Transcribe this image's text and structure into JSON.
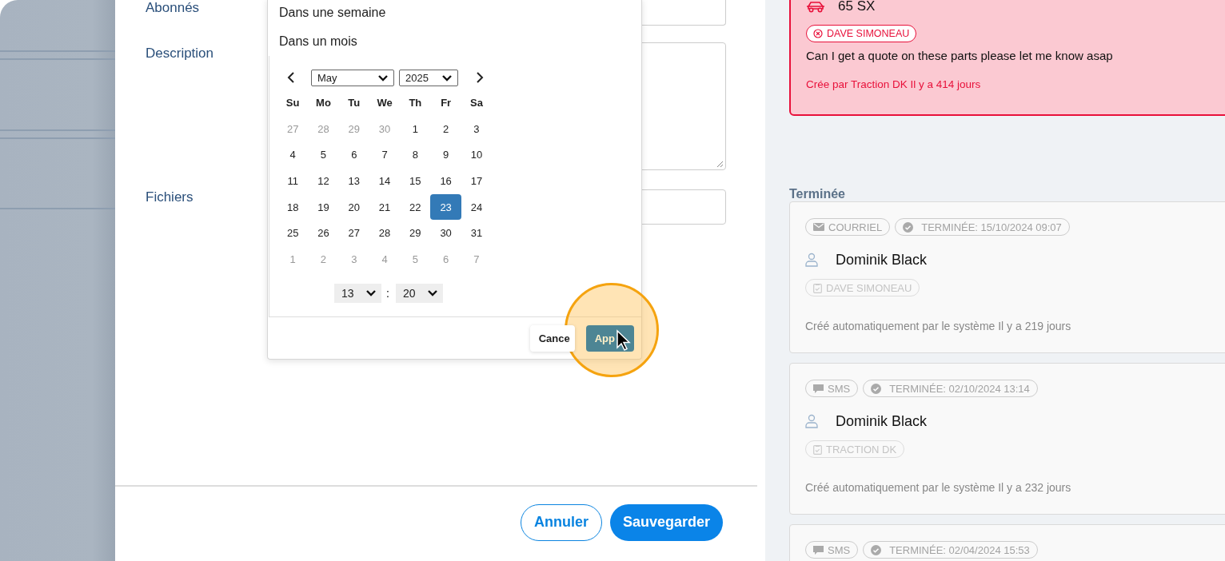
{
  "form": {
    "fields": [
      {
        "label": "Abonnés",
        "kind": "input"
      },
      {
        "label": "Description",
        "kind": "textarea"
      },
      {
        "label": "Fichiers",
        "kind": "file"
      }
    ]
  },
  "date_popover": {
    "presets": [
      "Dans une semaine",
      "Dans un mois"
    ],
    "calendar": {
      "month": "May",
      "year": "2025",
      "weekdays": [
        "Su",
        "Mo",
        "Tu",
        "We",
        "Th",
        "Fr",
        "Sa"
      ],
      "weeks": [
        [
          {
            "day": "27",
            "outside": true,
            "selected": false
          },
          {
            "day": "28",
            "outside": true,
            "selected": false
          },
          {
            "day": "29",
            "outside": true,
            "selected": false
          },
          {
            "day": "30",
            "outside": true,
            "selected": false
          },
          {
            "day": "1",
            "outside": false,
            "selected": false
          },
          {
            "day": "2",
            "outside": false,
            "selected": false
          },
          {
            "day": "3",
            "outside": false,
            "selected": false
          }
        ],
        [
          {
            "day": "4",
            "outside": false,
            "selected": false
          },
          {
            "day": "5",
            "outside": false,
            "selected": false
          },
          {
            "day": "6",
            "outside": false,
            "selected": false
          },
          {
            "day": "7",
            "outside": false,
            "selected": false
          },
          {
            "day": "8",
            "outside": false,
            "selected": false
          },
          {
            "day": "9",
            "outside": false,
            "selected": false
          },
          {
            "day": "10",
            "outside": false,
            "selected": false
          }
        ],
        [
          {
            "day": "11",
            "outside": false,
            "selected": false
          },
          {
            "day": "12",
            "outside": false,
            "selected": false
          },
          {
            "day": "13",
            "outside": false,
            "selected": false
          },
          {
            "day": "14",
            "outside": false,
            "selected": false
          },
          {
            "day": "15",
            "outside": false,
            "selected": false
          },
          {
            "day": "16",
            "outside": false,
            "selected": false
          },
          {
            "day": "17",
            "outside": false,
            "selected": false
          }
        ],
        [
          {
            "day": "18",
            "outside": false,
            "selected": false
          },
          {
            "day": "19",
            "outside": false,
            "selected": false
          },
          {
            "day": "20",
            "outside": false,
            "selected": false
          },
          {
            "day": "21",
            "outside": false,
            "selected": false
          },
          {
            "day": "22",
            "outside": false,
            "selected": false
          },
          {
            "day": "23",
            "outside": false,
            "selected": true
          },
          {
            "day": "24",
            "outside": false,
            "selected": false
          }
        ],
        [
          {
            "day": "25",
            "outside": false,
            "selected": false
          },
          {
            "day": "26",
            "outside": false,
            "selected": false
          },
          {
            "day": "27",
            "outside": false,
            "selected": false
          },
          {
            "day": "28",
            "outside": false,
            "selected": false
          },
          {
            "day": "29",
            "outside": false,
            "selected": false
          },
          {
            "day": "30",
            "outside": false,
            "selected": false
          },
          {
            "day": "31",
            "outside": false,
            "selected": false
          }
        ],
        [
          {
            "day": "1",
            "outside": true,
            "selected": false
          },
          {
            "day": "2",
            "outside": true,
            "selected": false
          },
          {
            "day": "3",
            "outside": true,
            "selected": false
          },
          {
            "day": "4",
            "outside": true,
            "selected": false
          },
          {
            "day": "5",
            "outside": true,
            "selected": false
          },
          {
            "day": "6",
            "outside": true,
            "selected": false
          },
          {
            "day": "7",
            "outside": true,
            "selected": false
          }
        ]
      ]
    },
    "time": {
      "hour": "13",
      "separator": ":",
      "minute": "20"
    },
    "buttons": [
      {
        "label": "Cance",
        "kind": "secondary"
      },
      {
        "label": "App",
        "kind": "primary"
      }
    ]
  },
  "footer_buttons": [
    {
      "label": "Annuler",
      "kind": "outline"
    },
    {
      "label": "Sauvegarder",
      "kind": "primary"
    }
  ],
  "overdue_card": {
    "vehicle": "65 SX",
    "assignee": "DAVE SIMONEAU",
    "message": "Can I get a quote on these parts please let me know asap",
    "meta": "Crée par Traction DK Il y a 414 jours"
  },
  "completed": {
    "heading": "Terminée",
    "tasks": [
      {
        "channel": "COURRIEL",
        "kind": "email",
        "status": "TERMINÉE: 15/10/2024 09:07",
        "contact": "Dominik Black",
        "assignee": "DAVE SIMONEAU",
        "meta": "Créé automatiquement par le système Il y a 219 jours"
      },
      {
        "channel": "SMS",
        "kind": "sms",
        "status": "TERMINÉE: 02/10/2024 13:14",
        "contact": "Dominik Black",
        "assignee": "TRACTION DK",
        "meta": "Créé automatiquement par le système Il y a 232 jours"
      },
      {
        "channel": "SMS",
        "kind": "sms",
        "status": "TERMINÉE: 02/04/2024 15:53"
      }
    ]
  }
}
